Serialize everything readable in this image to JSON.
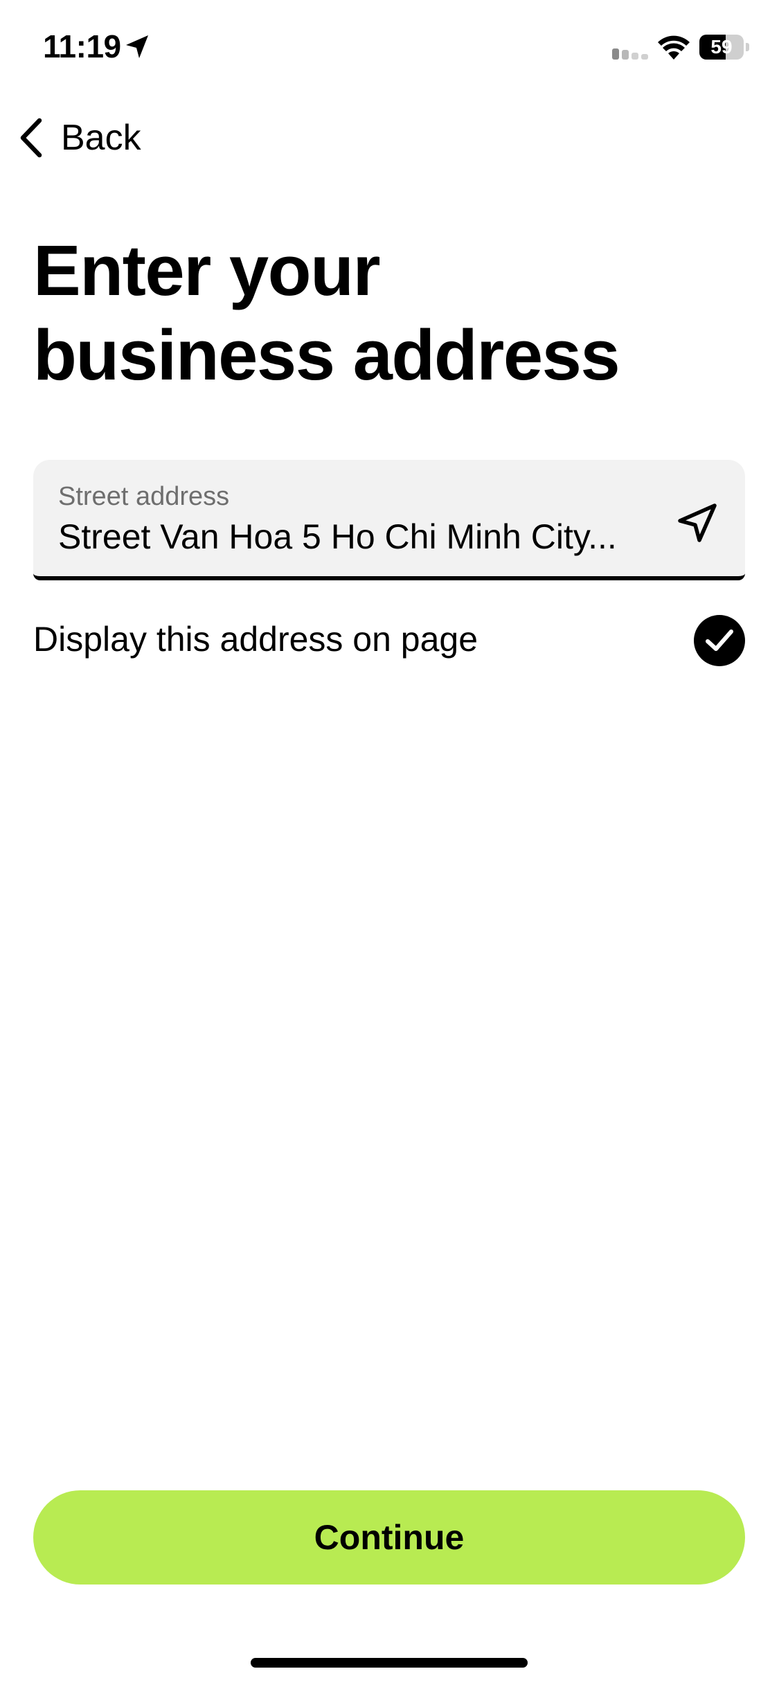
{
  "status_bar": {
    "time": "11:19",
    "battery_level": "59",
    "battery_fraction": 0.59,
    "icons": [
      "location-arrow-icon",
      "cellular-signal-icon",
      "wifi-icon",
      "battery-icon"
    ]
  },
  "nav": {
    "back_label": "Back",
    "back_icon": "chevron-left-icon"
  },
  "page": {
    "title_line1": "Enter your",
    "title_line2": "business address"
  },
  "address_field": {
    "label": "Street address",
    "value": "Street Van Hoa 5 Ho Chi Minh City...",
    "action_icon": "location-arrow-icon"
  },
  "display_option": {
    "label": "Display this address on page",
    "checked": true
  },
  "actions": {
    "continue_label": "Continue"
  },
  "colors": {
    "accent": "#b8eb52",
    "field_background": "#f2f2f2",
    "text": "#000000",
    "label_text": "#6e6e6e"
  }
}
